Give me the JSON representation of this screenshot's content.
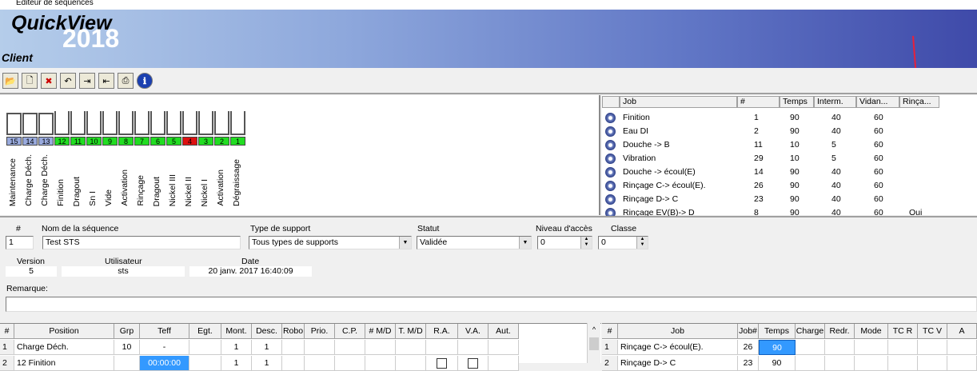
{
  "window": {
    "title": "Editeur de séquences"
  },
  "banner": {
    "logo": "QuickView",
    "year": "2018",
    "mode": "Client"
  },
  "colors": {
    "tank_ok": "#22dd22",
    "tank_alert": "#dd1111",
    "tank_special": "#99aadd"
  },
  "toolbar": {
    "icons": [
      "open-folder-icon",
      "new-document-icon",
      "delete-document-icon",
      "undo-icon",
      "export-icon",
      "import-icon",
      "print-icon",
      "info-icon"
    ]
  },
  "tanks": [
    {
      "num": "15",
      "name": "Maintenance",
      "status": "special"
    },
    {
      "num": "14",
      "name": "Charge Déch.",
      "status": "special"
    },
    {
      "num": "13",
      "name": "Charge Déch.",
      "status": "special"
    },
    {
      "num": "12",
      "name": "Finition",
      "status": "ok"
    },
    {
      "num": "11",
      "name": "Dragout",
      "status": "ok"
    },
    {
      "num": "10",
      "name": "Sn I",
      "status": "ok"
    },
    {
      "num": "9",
      "name": "Vide",
      "status": "ok"
    },
    {
      "num": "8",
      "name": "Activation",
      "status": "ok"
    },
    {
      "num": "7",
      "name": "Rinçage",
      "status": "ok"
    },
    {
      "num": "6",
      "name": "Dragout",
      "status": "ok"
    },
    {
      "num": "5",
      "name": "Nickel III",
      "status": "ok"
    },
    {
      "num": "4",
      "name": "Nickel II",
      "status": "alert"
    },
    {
      "num": "3",
      "name": "Nickel I",
      "status": "ok"
    },
    {
      "num": "2",
      "name": "Activation",
      "status": "ok"
    },
    {
      "num": "1",
      "name": "Dégraissage",
      "status": "ok"
    }
  ],
  "jobs": {
    "headers": [
      "Job",
      "#",
      "Temps",
      "Interm.",
      "Vidan...",
      "Rinça..."
    ],
    "rows": [
      [
        "Finition",
        "1",
        "90",
        "40",
        "60",
        ""
      ],
      [
        "Eau DI",
        "2",
        "90",
        "40",
        "60",
        ""
      ],
      [
        "Douche -> B",
        "11",
        "10",
        "5",
        "60",
        ""
      ],
      [
        "Vibration",
        "29",
        "10",
        "5",
        "60",
        ""
      ],
      [
        "Douche -> écoul(E)",
        "14",
        "90",
        "40",
        "60",
        ""
      ],
      [
        "Rinçage C-> écoul(E).",
        "26",
        "90",
        "40",
        "60",
        ""
      ],
      [
        "Rinçage D-> C",
        "23",
        "90",
        "40",
        "60",
        ""
      ],
      [
        "Rinçage EV(B)-> D",
        "8",
        "90",
        "40",
        "60",
        "Oui"
      ]
    ]
  },
  "form": {
    "num_label": "#",
    "num_value": "1",
    "name_label": "Nom de la séquence",
    "name_value": "Test STS",
    "support_label": "Type de support",
    "support_value": "Tous types de supports",
    "status_label": "Statut",
    "status_value": "Validée",
    "access_label": "Niveau d'accès",
    "access_value": "0",
    "class_label": "Classe",
    "class_value": "0",
    "version_label": "Version",
    "version_value": "5",
    "user_label": "Utilisateur",
    "user_value": "sts",
    "date_label": "Date",
    "date_value": "20 janv. 2017 16:40:09",
    "remark_label": "Remarque:",
    "remark_value": ""
  },
  "positions": {
    "headers": [
      "#",
      "Position",
      "Grp",
      "Teff",
      "Egt.",
      "Mont.",
      "Desc.",
      "Robo",
      "Prio.",
      "C.P.",
      "# M/D",
      "T. M/D",
      "R.A.",
      "V.A.",
      "Aut."
    ],
    "rows": [
      [
        "1",
        "Charge Déch.",
        "10",
        "-",
        "",
        "1",
        "1"
      ],
      [
        "2",
        "12 Finition",
        "",
        "00:00:00",
        "",
        "1",
        "1"
      ]
    ]
  },
  "pos_jobs": {
    "headers": [
      "#",
      "Job",
      "Job#",
      "Temps",
      "Charge",
      "Redr.",
      "Mode",
      "TC R",
      "TC V",
      "A"
    ],
    "rows": [
      [
        "1",
        "Rinçage C-> écoul(E).",
        "26",
        "90"
      ],
      [
        "2",
        "Rinçage D-> C",
        "23",
        "90"
      ]
    ]
  }
}
